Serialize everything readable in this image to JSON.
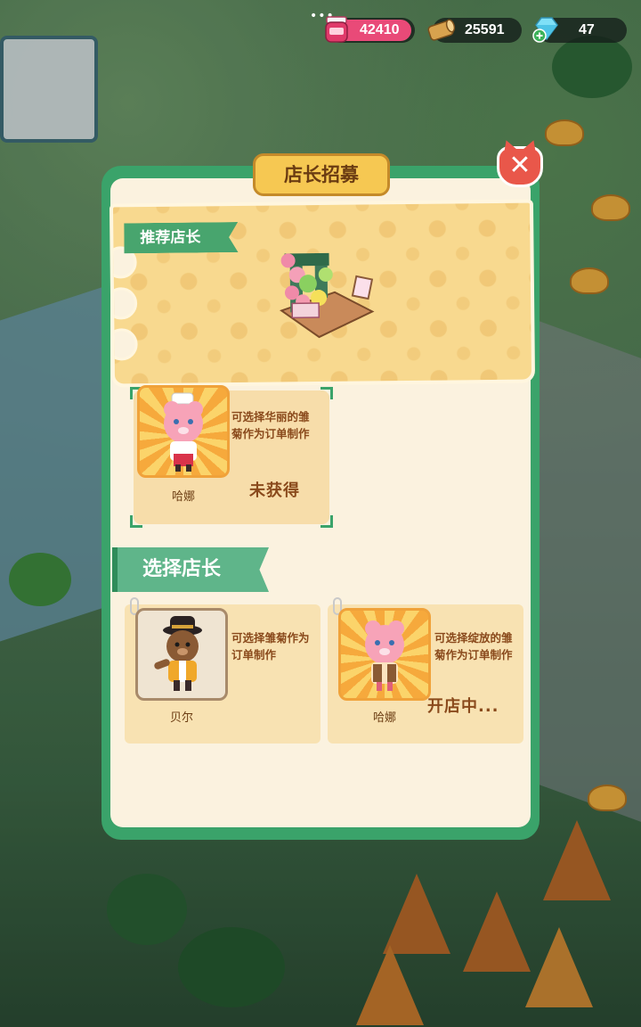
{
  "top_bar": {
    "menu_dots": "•••",
    "resources": [
      {
        "icon": "jam-jar-icon",
        "value": "42410",
        "color": "#e94a78"
      },
      {
        "icon": "wood-log-icon",
        "value": "25591"
      },
      {
        "icon": "diamond-plus-icon",
        "value": "47",
        "color": "#6fd3f0"
      }
    ]
  },
  "modal": {
    "title": "店长招募",
    "close_icon": "close-icon",
    "recommended": {
      "ribbon": "推荐店长",
      "owner": {
        "name": "哈娜",
        "description_line1": "可选择华丽的雏",
        "description_line2": "菊作为订单制作",
        "status": "未获得"
      }
    },
    "select_section": {
      "ribbon": "选择店长",
      "owners": [
        {
          "name": "贝尔",
          "description_line1": "可选择雏菊作为",
          "description_line2": "订单制作",
          "status": ""
        },
        {
          "name": "哈娜",
          "description_line1": "可选择绽放的雏",
          "description_line2": "菊作为订单制作",
          "status": "开店中..."
        }
      ]
    }
  },
  "colors": {
    "frame_green": "#3aa36a",
    "panel_cream": "#fbf2df",
    "title_gold": "#f6c852",
    "close_red": "#e9574a",
    "text_brown": "#8a4a1c"
  }
}
